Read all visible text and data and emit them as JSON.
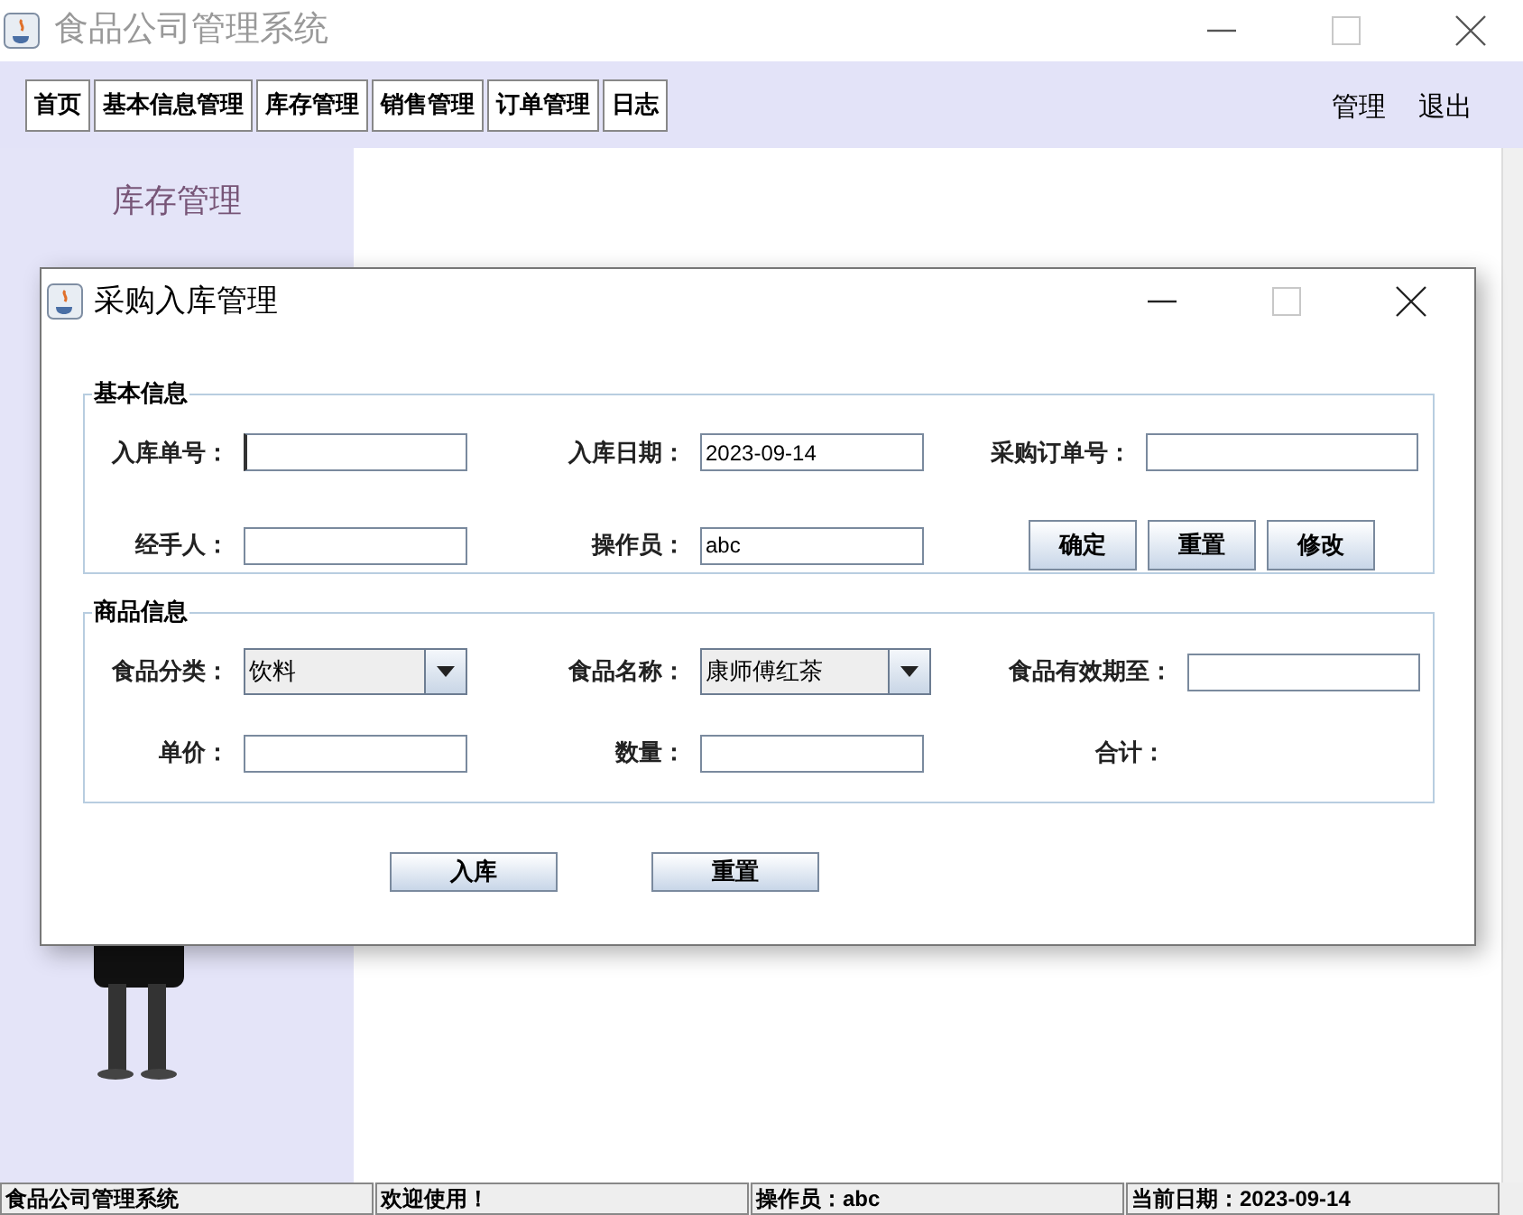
{
  "main_window": {
    "title": "食品公司管理系统"
  },
  "menu_tabs": [
    {
      "label": "首页"
    },
    {
      "label": "基本信息管理"
    },
    {
      "label": "库存管理"
    },
    {
      "label": "销售管理"
    },
    {
      "label": "订单管理"
    },
    {
      "label": "日志"
    }
  ],
  "right_links": [
    "管理",
    "退出"
  ],
  "sidebar": {
    "title": "库存管理"
  },
  "dialog": {
    "title": "采购入库管理",
    "basic_info": {
      "legend": "基本信息",
      "rows": [
        [
          {
            "kind": "text",
            "label": "入库单号：",
            "focused": true
          },
          {
            "kind": "text",
            "label": "入库日期：",
            "value": "2023-09-14"
          },
          {
            "kind": "text",
            "label": "采购订单号："
          }
        ],
        [
          {
            "kind": "text",
            "label": "经手人："
          },
          {
            "kind": "text",
            "label": "操作员：",
            "value": "abc"
          },
          {
            "kind": "buttons",
            "buttons": [
              "确定",
              "重置",
              "修改"
            ]
          }
        ]
      ]
    },
    "goods_info": {
      "legend": "商品信息",
      "rows": [
        [
          {
            "kind": "combo",
            "label": "食品分类：",
            "value": "饮料"
          },
          {
            "kind": "combo",
            "label": "食品名称：",
            "value": "康师傅红茶"
          },
          {
            "kind": "text",
            "label": "食品有效期至："
          }
        ],
        [
          {
            "kind": "text",
            "label": "单价："
          },
          {
            "kind": "text",
            "label": "数量："
          },
          {
            "kind": "readout",
            "label": "合计："
          }
        ]
      ]
    },
    "buttons": [
      "入库",
      "重置"
    ]
  },
  "status_bar": [
    "食品公司管理系统",
    "欢迎使用！",
    "操作员：abc",
    "当前日期：2023-09-14"
  ]
}
